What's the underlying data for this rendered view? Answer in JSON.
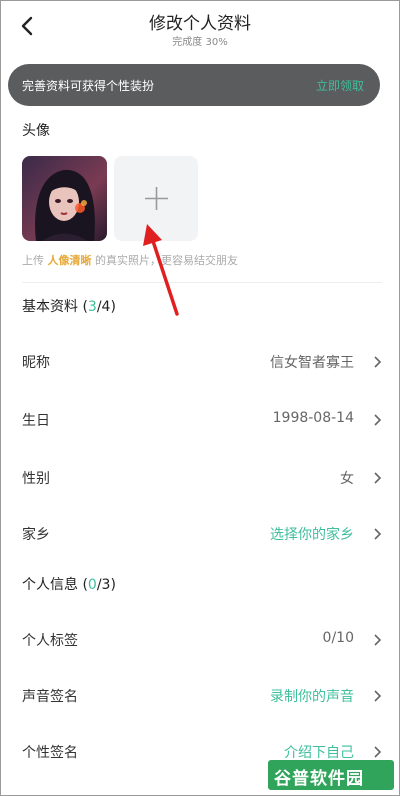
{
  "header": {
    "title": "修改个人资料",
    "completion": "完成度 30%"
  },
  "banner": {
    "text": "完善资料可获得个性装扮",
    "action": "立即领取"
  },
  "avatar_section": {
    "label": "头像",
    "hint_prefix": "上传",
    "hint_highlight": "人像清晰",
    "hint_suffix": "的真实照片，更容易结交朋友"
  },
  "basic": {
    "title": "基本资料 (",
    "count_done": "3",
    "count_total": "/4)",
    "rows": [
      {
        "label": "昵称",
        "value": "信女智者寡王"
      },
      {
        "label": "生日",
        "value": "1998-08-14"
      },
      {
        "label": "性别",
        "value": "女"
      },
      {
        "label": "家乡",
        "value": "选择你的家乡"
      }
    ]
  },
  "personal": {
    "title": "个人信息 (",
    "count_done": "0",
    "count_total": "/3)",
    "rows": [
      {
        "label": "个人标签",
        "value": "0/10"
      },
      {
        "label": "声音签名",
        "value": "录制你的声音"
      },
      {
        "label": "个性签名",
        "value": "介绍下自己"
      }
    ]
  },
  "watermark": "谷普软件园",
  "colors": {
    "accent": "#3fbf9b",
    "highlight": "#e8a93a",
    "banner_bg": "#5a5c5e",
    "arrow": "#e02020"
  }
}
